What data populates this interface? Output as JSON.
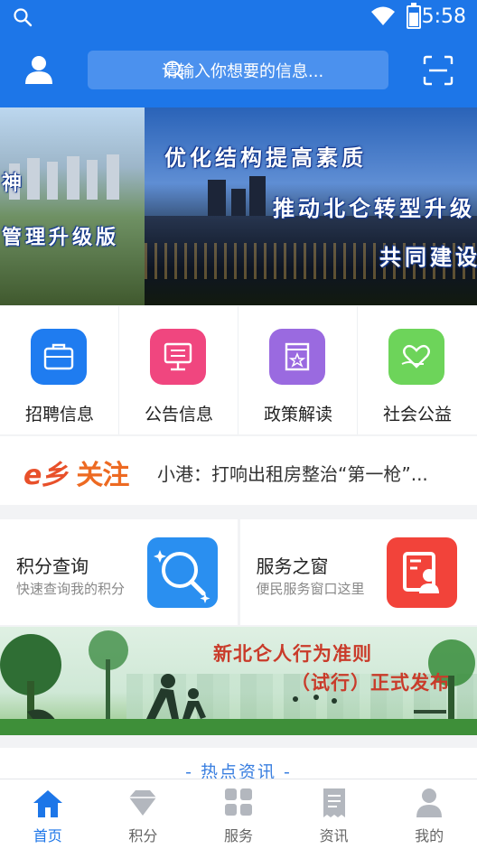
{
  "status": {
    "time": "5:58"
  },
  "header": {
    "search_placeholder": "请输入你想要的信息..."
  },
  "banner": {
    "lines": [
      "优化结构提高素质",
      "推动北仑转型升级",
      "共同建设",
      "神",
      "管理升级版"
    ]
  },
  "grid": {
    "items": [
      {
        "label": "招聘信息",
        "icon": "briefcase-icon",
        "color": "#1f7cf0"
      },
      {
        "label": "公告信息",
        "icon": "billboard-icon",
        "color": "#f0467f"
      },
      {
        "label": "政策解读",
        "icon": "building-icon",
        "color": "#9a6ae0"
      },
      {
        "label": "社会公益",
        "icon": "heart-hand-icon",
        "color": "#6dd45a"
      }
    ]
  },
  "ticker": {
    "brand_e": "e乡",
    "brand_follow": "关注",
    "headline": "小港：打响出租房整治“第一枪”..."
  },
  "cards": [
    {
      "title": "积分查询",
      "subtitle": "快速查询我的积分",
      "icon": "magnifier-icon",
      "color": "#2a8ff0"
    },
    {
      "title": "服务之窗",
      "subtitle": "便民服务窗口这里",
      "icon": "service-window-icon",
      "color": "#f2433a"
    }
  ],
  "promo": {
    "line1": "新北仑人行为准则",
    "line2": "（试行）正式发布"
  },
  "hot": {
    "title": "- 热点资讯 -"
  },
  "tabbar": {
    "active_color": "#1d76e8",
    "items": [
      {
        "label": "首页",
        "icon": "home-icon"
      },
      {
        "label": "积分",
        "icon": "diamond-icon"
      },
      {
        "label": "服务",
        "icon": "grid-icon"
      },
      {
        "label": "资讯",
        "icon": "news-icon"
      },
      {
        "label": "我的",
        "icon": "person-icon"
      }
    ]
  }
}
